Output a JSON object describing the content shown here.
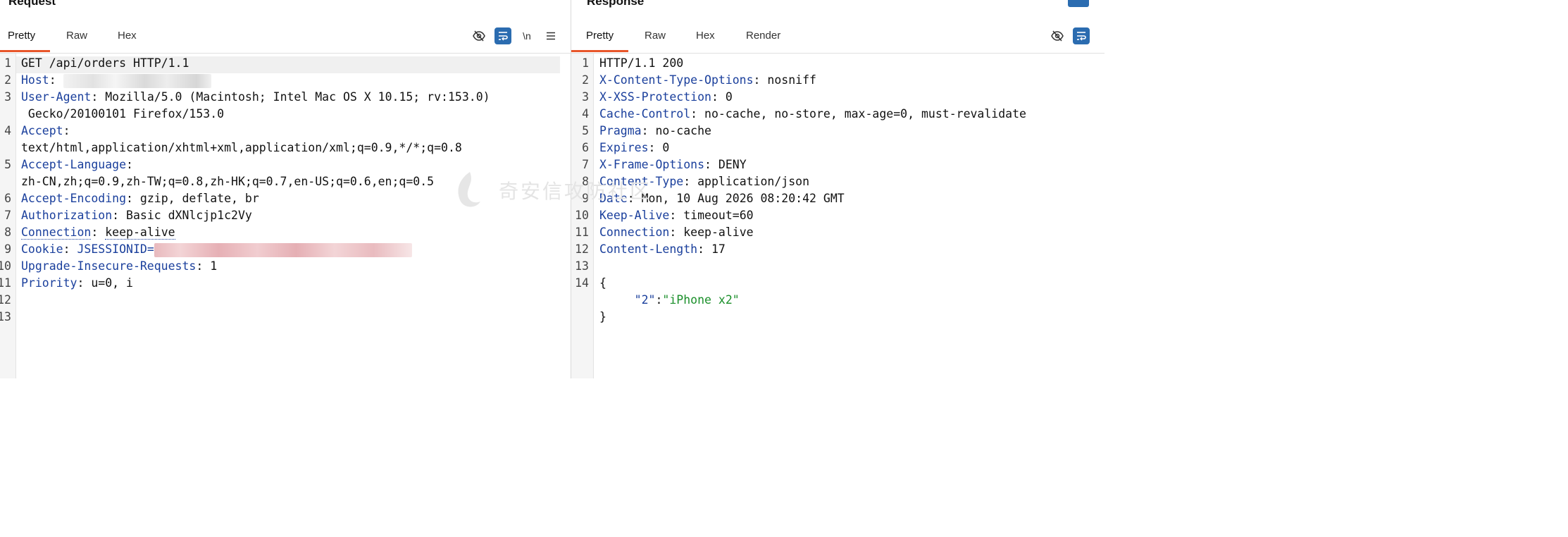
{
  "request": {
    "title": "Request",
    "tabs": [
      "Pretty",
      "Raw",
      "Hex"
    ],
    "active_tab": "Pretty",
    "tool_newline_label": "\\n",
    "lines": [
      {
        "n": "1",
        "key": "",
        "sep": "",
        "value": "GET /api/orders HTTP/1.1"
      },
      {
        "n": "2",
        "key": "Host",
        "sep": ": ",
        "value": ""
      },
      {
        "n": "3",
        "key": "User-Agent",
        "sep": ": ",
        "value": "Mozilla/5.0 (Macintosh; Intel Mac OS X 10.15; rv:153.0)"
      },
      {
        "n": "",
        "key": "",
        "sep": "",
        "value": " Gecko/20100101 Firefox/153.0"
      },
      {
        "n": "4",
        "key": "Accept",
        "sep": ":",
        "value": ""
      },
      {
        "n": "",
        "key": "",
        "sep": "",
        "value": "text/html,application/xhtml+xml,application/xml;q=0.9,*/*;q=0.8"
      },
      {
        "n": "5",
        "key": "Accept-Language",
        "sep": ":",
        "value": ""
      },
      {
        "n": "",
        "key": "",
        "sep": "",
        "value": "zh-CN,zh;q=0.9,zh-TW;q=0.8,zh-HK;q=0.7,en-US;q=0.6,en;q=0.5"
      },
      {
        "n": "6",
        "key": "Accept-Encoding",
        "sep": ": ",
        "value": "gzip, deflate, br"
      },
      {
        "n": "7",
        "key": "Authorization",
        "sep": ": ",
        "value": "Basic dXNlcjp1c2Vy"
      },
      {
        "n": "8",
        "key": "Connection",
        "sep": ": ",
        "value": "keep-alive"
      },
      {
        "n": "9",
        "key": "Cookie",
        "sep": ": ",
        "value": "JSESSIONID="
      },
      {
        "n": "10",
        "key": "Upgrade-Insecure-Requests",
        "sep": ": ",
        "value": "1"
      },
      {
        "n": "11",
        "key": "Priority",
        "sep": ": ",
        "value": "u=0, i"
      },
      {
        "n": "12",
        "key": "",
        "sep": "",
        "value": ""
      },
      {
        "n": "13",
        "key": "",
        "sep": "",
        "value": ""
      }
    ]
  },
  "response": {
    "title": "Response",
    "tabs": [
      "Pretty",
      "Raw",
      "Hex",
      "Render"
    ],
    "active_tab": "Pretty",
    "lines": [
      {
        "n": "1",
        "key": "",
        "sep": "",
        "value": "HTTP/1.1 200"
      },
      {
        "n": "2",
        "key": "X-Content-Type-Options",
        "sep": ": ",
        "value": "nosniff"
      },
      {
        "n": "3",
        "key": "X-XSS-Protection",
        "sep": ": ",
        "value": "0"
      },
      {
        "n": "4",
        "key": "Cache-Control",
        "sep": ": ",
        "value": "no-cache, no-store, max-age=0, must-revalidate"
      },
      {
        "n": "5",
        "key": "Pragma",
        "sep": ": ",
        "value": "no-cache"
      },
      {
        "n": "6",
        "key": "Expires",
        "sep": ": ",
        "value": "0"
      },
      {
        "n": "7",
        "key": "X-Frame-Options",
        "sep": ": ",
        "value": "DENY"
      },
      {
        "n": "8",
        "key": "Content-Type",
        "sep": ": ",
        "value": "application/json"
      },
      {
        "n": "9",
        "key": "Date",
        "sep": ": ",
        "value": "Mon, 10 Aug 2026 08:20:42 GMT"
      },
      {
        "n": "10",
        "key": "Keep-Alive",
        "sep": ": ",
        "value": "timeout=60"
      },
      {
        "n": "11",
        "key": "Connection",
        "sep": ": ",
        "value": "keep-alive"
      },
      {
        "n": "12",
        "key": "Content-Length",
        "sep": ": ",
        "value": "17"
      },
      {
        "n": "13",
        "key": "",
        "sep": "",
        "value": ""
      },
      {
        "n": "14",
        "key": "",
        "sep": "",
        "value": "{"
      },
      {
        "n": "",
        "key": "",
        "sep": "",
        "value": "",
        "json_key": "\"2\"",
        "json_sep": ":",
        "json_val": "\"iPhone x2\""
      },
      {
        "n": "",
        "key": "",
        "sep": "",
        "value": "}"
      }
    ]
  },
  "watermark": "奇安信攻防社区",
  "colors": {
    "accent_tab": "#e8562a",
    "header_key": "#1a3f9c",
    "json_string": "#1a8f2a",
    "toggle_on": "#2b6cb0"
  },
  "icons": [
    "eye-off-icon",
    "wrap-icon",
    "newline-icon",
    "menu-icon"
  ]
}
